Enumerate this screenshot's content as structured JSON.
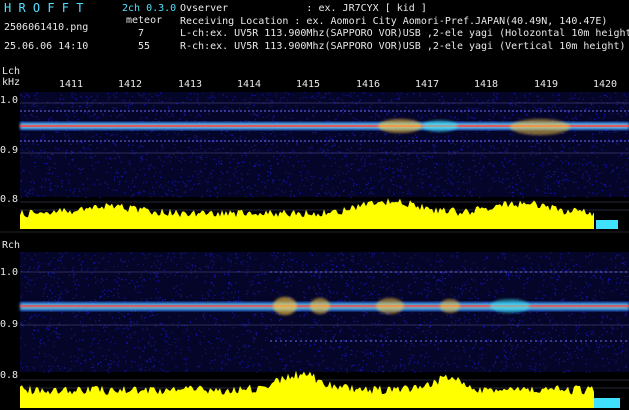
{
  "header": {
    "brand": "H R O F F T",
    "version": "2ch 0.3.0",
    "filename": "2506061410.png",
    "mode": "meteor",
    "datetime": "25.06.06 14:10",
    "count1": "7",
    "count2": "55",
    "info_lines": [
      "Ovserver             : ex. JR7CYX [ kid ]",
      "Receiving Location : ex. Aomori City Aomori-Pref.JAPAN(40.49N, 140.47E)",
      "L-ch:ex. UV5R 113.900Mhz(SAPPORO VOR)USB ,2-ele yagi (Holozontal 10m height)",
      "R-ch:ex. UV5R 113.900Mhz(SAPPORO VOR)USB ,2-ele yagi (Vertical 10m height)"
    ]
  },
  "lch": {
    "label": "Lch",
    "unit": "kHz",
    "y_ticks": [
      "1.0",
      "0.9",
      "0.8"
    ]
  },
  "rch": {
    "label": "Rch",
    "y_ticks": [
      "1.0",
      "0.9",
      "0.8"
    ]
  },
  "time_ticks": [
    "1411",
    "1412",
    "1413",
    "1414",
    "1415",
    "1416",
    "1417",
    "1418",
    "1419",
    "1420"
  ],
  "colors": {
    "cyan": "#4fe0ff",
    "yellow": "#ffff00",
    "noise": "#1a1a8c"
  }
}
